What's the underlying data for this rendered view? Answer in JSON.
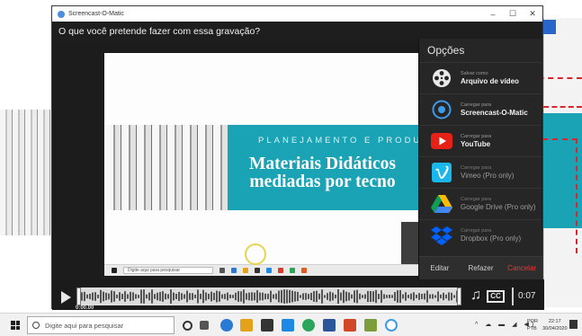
{
  "window": {
    "title": "Screencast-O-Matic",
    "question": "O que você pretende fazer com essa gravação?",
    "controls": {
      "minimize": "–",
      "maximize": "☐",
      "close": "✕"
    }
  },
  "preview": {
    "banner_subtitle": "PLANEJAMENTO E PRODU",
    "banner_title_line1": "Materiais Didáticos",
    "banner_title_line2": "mediadas por tecno",
    "taskbar_search": "Digite aqui para pesquisar"
  },
  "options": {
    "title": "Opções",
    "items": [
      {
        "small": "Salvar como",
        "main": "Arquivo de vídeo",
        "icon": "film-reel-icon"
      },
      {
        "small": "Carregar para",
        "main": "Screencast-O-Matic",
        "icon": "screencast-logo-icon"
      },
      {
        "small": "Carregar para",
        "main": "YouTube",
        "icon": "youtube-icon"
      },
      {
        "small": "Carregar para",
        "main": "Vimeo (Pro only)",
        "icon": "vimeo-icon"
      },
      {
        "small": "Carregar para",
        "main": "Google Drive (Pro only)",
        "icon": "google-drive-icon"
      },
      {
        "small": "Carregar para",
        "main": "Dropbox (Pro only)",
        "icon": "dropbox-icon"
      }
    ],
    "footer": {
      "edit": "Editar",
      "redo": "Refazer",
      "cancel": "Cancelar"
    }
  },
  "player": {
    "time_start": "0:00.00",
    "duration": "0:07",
    "cc_label": "CC"
  },
  "taskbar": {
    "search_placeholder": "Digite aqui para pesquisar",
    "tray_icons": "^ ☁ ▬ ◢ ◀)",
    "lang_line1": "POR",
    "lang_line2": "PTB",
    "time": "22:17",
    "date": "30/04/2020"
  },
  "colors": {
    "teal_banner": "#1aa3b5",
    "cancel_red": "#e23b3b",
    "youtube_red": "#e62117",
    "vimeo_blue": "#1ab7ea",
    "dropbox_blue": "#0061fe"
  }
}
